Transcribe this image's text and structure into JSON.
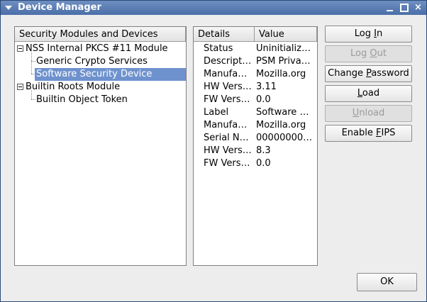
{
  "window": {
    "title": "Device Manager",
    "close_glyph": "×"
  },
  "tree": {
    "header": "Security Modules and Devices",
    "rows": [
      {
        "label": "NSS Internal PKCS #11 Module",
        "level": 0,
        "expandable": true
      },
      {
        "label": "Generic Crypto Services",
        "level": 1
      },
      {
        "label": "Software Security Device",
        "level": 1,
        "selected": true
      },
      {
        "label": "Builtin Roots Module",
        "level": 0,
        "expandable": true
      },
      {
        "label": "Builtin Object Token",
        "level": 1
      }
    ]
  },
  "details": {
    "headers": [
      "Details",
      "Value"
    ],
    "rows": [
      {
        "key": "Status",
        "value": "Uninitialized"
      },
      {
        "key": "Descripti…",
        "value": "PSM Privat…"
      },
      {
        "key": "Manufac…",
        "value": "Mozilla.org"
      },
      {
        "key": "HW Versi…",
        "value": "3.11"
      },
      {
        "key": "FW Versi…",
        "value": "0.0"
      },
      {
        "key": "Label",
        "value": "Software S…"
      },
      {
        "key": "Manufac…",
        "value": "Mozilla.org"
      },
      {
        "key": "Serial Nu…",
        "value": "00000000…"
      },
      {
        "key": "HW Versi…",
        "value": "8.3"
      },
      {
        "key": "FW Versi…",
        "value": "0.0"
      }
    ]
  },
  "buttons": {
    "log_in": {
      "pre": "Log ",
      "acc": "I",
      "post": "n"
    },
    "log_out": {
      "pre": "Log ",
      "acc": "O",
      "post": "ut"
    },
    "change_password": {
      "pre": "Change ",
      "acc": "P",
      "post": "assword"
    },
    "load": {
      "pre": "",
      "acc": "L",
      "post": "oad"
    },
    "unload": {
      "pre": "",
      "acc": "U",
      "post": "nload"
    },
    "enable_fips": {
      "pre": "Enable ",
      "acc": "F",
      "post": "IPS"
    },
    "ok": "OK"
  },
  "colors": {
    "titlebar": "#4a6ea8",
    "selection": "#6e92cd"
  }
}
